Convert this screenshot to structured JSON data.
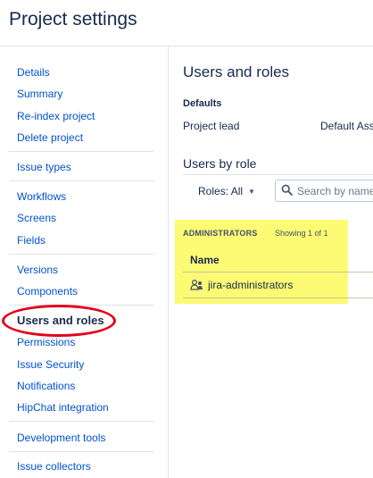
{
  "header": {
    "title": "Project settings"
  },
  "sidebar": {
    "items": [
      {
        "label": "Details"
      },
      {
        "label": "Summary"
      },
      {
        "label": "Re-index project"
      },
      {
        "label": "Delete project"
      },
      {
        "label": "Issue types"
      },
      {
        "label": "Workflows"
      },
      {
        "label": "Screens"
      },
      {
        "label": "Fields"
      },
      {
        "label": "Versions"
      },
      {
        "label": "Components"
      },
      {
        "label": "Users and roles",
        "active": true
      },
      {
        "label": "Permissions"
      },
      {
        "label": "Issue Security"
      },
      {
        "label": "Notifications"
      },
      {
        "label": "HipChat integration"
      },
      {
        "label": "Development tools"
      },
      {
        "label": "Issue collectors"
      }
    ]
  },
  "main": {
    "title": "Users and roles",
    "defaults": {
      "heading": "Defaults",
      "project_lead_label": "Project lead",
      "default_assignee_label": "Default Ass"
    },
    "by_role": {
      "title": "Users by role",
      "roles_filter": "Roles: All",
      "search_placeholder": "Search by name"
    },
    "role_section": {
      "name": "ADMINISTRATORS",
      "showing": "Showing 1 of 1",
      "column_header": "Name",
      "groups": [
        {
          "name": "jira-administrators",
          "icon": "group-icon"
        }
      ]
    }
  },
  "annotations": {
    "highlight_color": "#fdf95b",
    "circle_color": "#e3001b"
  }
}
